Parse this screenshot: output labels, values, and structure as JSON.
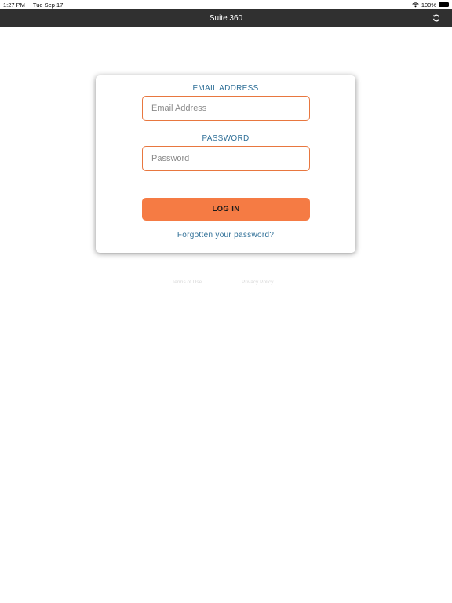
{
  "status_bar": {
    "time": "1:27 PM",
    "date": "Tue Sep 17",
    "battery": "100%",
    "icons": [
      "wifi-icon",
      "battery-icon"
    ]
  },
  "nav": {
    "title": "Suite 360",
    "right_icon": "refresh-icon"
  },
  "login": {
    "email_label": "EMAIL ADDRESS",
    "email_placeholder": "Email Address",
    "email_value": "",
    "password_label": "PASSWORD",
    "password_placeholder": "Password",
    "password_value": "",
    "login_button": "LOG IN",
    "forgot_link": "Forgotten your password?"
  },
  "footer": {
    "terms": "Terms of Use",
    "privacy": "Privacy Policy"
  },
  "colors": {
    "accent": "#f57b44",
    "input_border": "#e8773f",
    "label": "#2f6f97",
    "nav_bg": "#303030"
  }
}
